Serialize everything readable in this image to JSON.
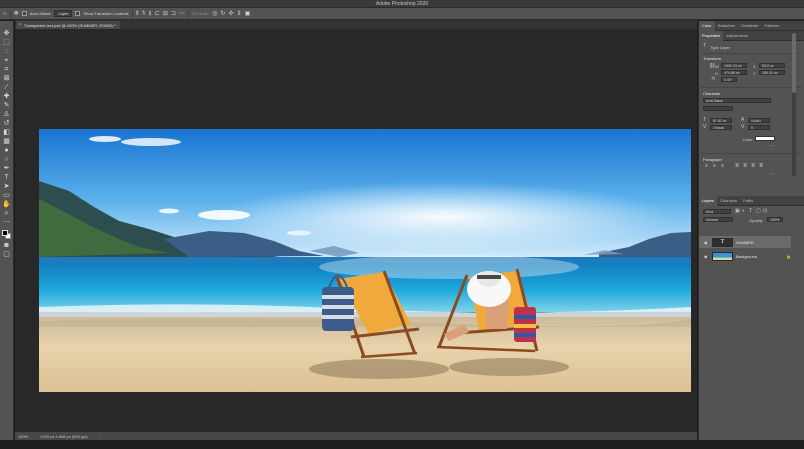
{
  "app": {
    "title": "Adobe Photoshop 2020"
  },
  "options_bar": {
    "auto_select_label": "Auto-Select:",
    "auto_select_value": "Layer",
    "transform_label": "Show Transform Controls",
    "mode_3d": "3D Mode:"
  },
  "document": {
    "tab_title": "Transparent text.psd @ 100% (SUMMER, RGB/8) *"
  },
  "status": {
    "zoom": "100%",
    "dimensions": "2100 px x 848 px (300 ppi)"
  },
  "panels": {
    "top_tabs": [
      "Color",
      "Swatches",
      "Gradients",
      "Patterns"
    ],
    "props_tabs": [
      "Properties",
      "Adjustments"
    ],
    "layer_type": "Type Layer",
    "transform": {
      "header": "Transform",
      "w": "1990.33 px",
      "x": "53.8 px",
      "h": "474.88 px",
      "y": "180.31 px",
      "angle": "0.00°"
    },
    "character": {
      "header": "Character",
      "font": "Arial Black",
      "size": "87.82 pt",
      "leading": "(Auto)",
      "kerning": "Optical",
      "tracking": "0",
      "color_label": "Color"
    },
    "paragraph": {
      "header": "Paragraph"
    }
  },
  "layers": {
    "tabs": [
      "Layers",
      "Channels",
      "Paths"
    ],
    "kind_label": "Kind",
    "blend_mode": "Normal",
    "opacity_label": "Opacity:",
    "opacity_value": "100%",
    "items": [
      {
        "name": "SUMMER",
        "type": "text"
      },
      {
        "name": "Background",
        "type": "image"
      }
    ]
  },
  "colors": {
    "panel": "#535353",
    "canvas_bg": "#282828",
    "sky_top": "#1f7fd8",
    "sea": "#1aa2d8",
    "sand": "#e6cfa6"
  }
}
